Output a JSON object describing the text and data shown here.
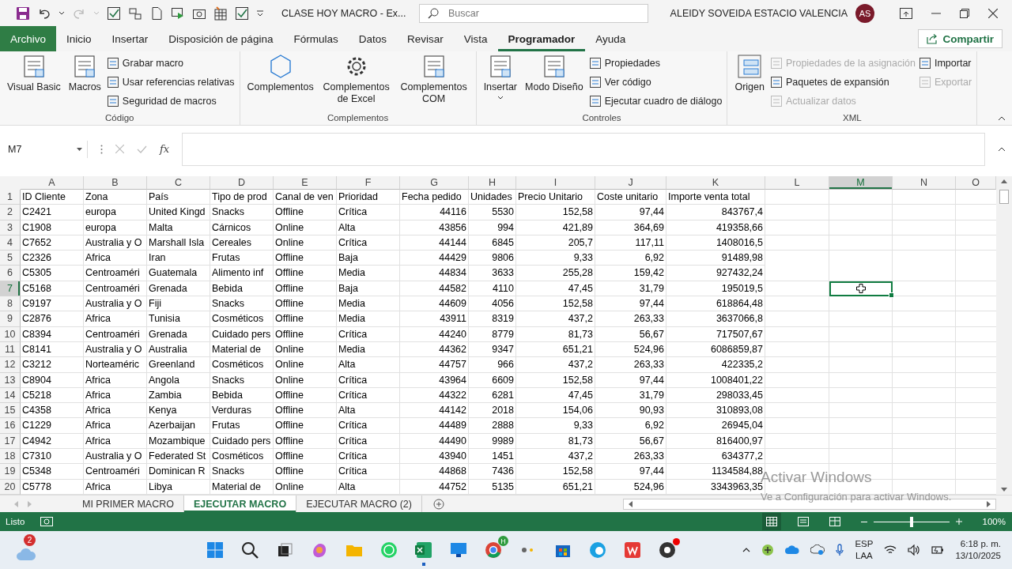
{
  "title_bar": {
    "title": "CLASE HOY MACRO  -  Ex...",
    "search": {
      "placeholder": "Buscar"
    },
    "user_name": "ALEIDY SOVEIDA ESTACIO VALENCIA",
    "avatar": "AS"
  },
  "menu_tabs": [
    {
      "label": "Archivo",
      "kind": "file",
      "selected": false
    },
    {
      "label": "Inicio",
      "kind": "tab",
      "selected": false
    },
    {
      "label": "Insertar",
      "kind": "tab",
      "selected": false
    },
    {
      "label": "Disposición de página",
      "kind": "tab",
      "selected": false
    },
    {
      "label": "Fórmulas",
      "kind": "tab",
      "selected": false
    },
    {
      "label": "Datos",
      "kind": "tab",
      "selected": false
    },
    {
      "label": "Revisar",
      "kind": "tab",
      "selected": false
    },
    {
      "label": "Vista",
      "kind": "tab",
      "selected": false
    },
    {
      "label": "Programador",
      "kind": "tab",
      "selected": true
    },
    {
      "label": "Ayuda",
      "kind": "tab",
      "selected": false
    }
  ],
  "share_button": "Compartir",
  "ribbon_groups": [
    {
      "label": "Código",
      "items": [
        {
          "kind": "large",
          "label": "Visual Basic",
          "disabled": false
        },
        {
          "kind": "large",
          "label": "Macros",
          "disabled": false
        },
        {
          "kind": "small",
          "label": "Grabar macro",
          "disabled": false
        },
        {
          "kind": "small",
          "label": "Usar referencias relativas",
          "disabled": false
        },
        {
          "kind": "small",
          "label": "Seguridad de macros",
          "disabled": false
        }
      ]
    },
    {
      "label": "Complementos",
      "items": [
        {
          "kind": "large",
          "label": "Complementos",
          "disabled": false
        },
        {
          "kind": "large",
          "label": "Complementos de Excel",
          "disabled": false
        },
        {
          "kind": "large",
          "label": "Complementos COM",
          "disabled": false
        }
      ]
    },
    {
      "label": "Controles",
      "items": [
        {
          "kind": "dropdown",
          "label": "Insertar",
          "disabled": false
        },
        {
          "kind": "large",
          "label": "Modo Diseño",
          "disabled": false
        },
        {
          "kind": "small",
          "label": "Propiedades",
          "disabled": false
        },
        {
          "kind": "small",
          "label": "Ver código",
          "disabled": false
        },
        {
          "kind": "small",
          "label": "Ejecutar cuadro de diálogo",
          "disabled": false
        }
      ]
    },
    {
      "label": "XML",
      "items": [
        {
          "kind": "large",
          "label": "Origen",
          "disabled": false
        },
        {
          "kind": "small",
          "label": "Propiedades de la asignación",
          "disabled": true
        },
        {
          "kind": "small",
          "label": "Paquetes de expansión",
          "disabled": false
        },
        {
          "kind": "small",
          "label": "Actualizar datos",
          "disabled": true
        },
        {
          "kind": "small",
          "label": "Importar",
          "disabled": false
        },
        {
          "kind": "small",
          "label": "Exportar",
          "disabled": true
        }
      ]
    }
  ],
  "formula_bar": {
    "name_box": "M7",
    "fx": "fx"
  },
  "columns": [
    {
      "letter": "A",
      "kind": "text",
      "selected": false
    },
    {
      "letter": "B",
      "kind": "text",
      "selected": false
    },
    {
      "letter": "C",
      "kind": "text",
      "selected": false
    },
    {
      "letter": "D",
      "kind": "text",
      "selected": false
    },
    {
      "letter": "E",
      "kind": "text",
      "selected": false
    },
    {
      "letter": "F",
      "kind": "text",
      "selected": false
    },
    {
      "letter": "G",
      "kind": "number",
      "selected": false
    },
    {
      "letter": "H",
      "kind": "number",
      "selected": false
    },
    {
      "letter": "I",
      "kind": "number",
      "selected": false
    },
    {
      "letter": "J",
      "kind": "number",
      "selected": false
    },
    {
      "letter": "K",
      "kind": "number",
      "selected": false
    },
    {
      "letter": "L",
      "kind": "text",
      "selected": false
    },
    {
      "letter": "M",
      "kind": "text",
      "selected": true
    },
    {
      "letter": "N",
      "kind": "text",
      "selected": false
    },
    {
      "letter": "O",
      "kind": "text",
      "selected": false
    }
  ],
  "rows": [
    {
      "number": "1",
      "kind": "header",
      "selected": false,
      "cells": [
        "ID Cliente",
        "Zona",
        "País",
        "Tipo de prod",
        "Canal de ven",
        "Prioridad",
        "Fecha pedido",
        "Unidades",
        "Precio Unitario",
        "Coste unitario",
        "Importe venta total"
      ]
    },
    {
      "number": "2",
      "kind": "data",
      "selected": false,
      "cells": [
        "C2421",
        "europa",
        "United Kingd",
        "Snacks",
        "Offline",
        "Crítica",
        "44116",
        "5530",
        "152,58",
        "97,44",
        "843767,4"
      ]
    },
    {
      "number": "3",
      "kind": "data",
      "selected": false,
      "cells": [
        "C1908",
        "europa",
        "Malta",
        "Cárnicos",
        "Online",
        "Alta",
        "43856",
        "994",
        "421,89",
        "364,69",
        "419358,66"
      ]
    },
    {
      "number": "4",
      "kind": "data",
      "selected": false,
      "cells": [
        "C7652",
        "Australia y O",
        "Marshall Isla",
        "Cereales",
        "Online",
        "Crítica",
        "44144",
        "6845",
        "205,7",
        "117,11",
        "1408016,5"
      ]
    },
    {
      "number": "5",
      "kind": "data",
      "selected": false,
      "cells": [
        "C2326",
        "Africa",
        "Iran",
        "Frutas",
        "Offline",
        "Baja",
        "44429",
        "9806",
        "9,33",
        "6,92",
        "91489,98"
      ]
    },
    {
      "number": "6",
      "kind": "data",
      "selected": false,
      "cells": [
        "C5305",
        "Centroaméri",
        "Guatemala",
        "Alimento inf",
        "Offline",
        "Media",
        "44834",
        "3633",
        "255,28",
        "159,42",
        "927432,24"
      ]
    },
    {
      "number": "7",
      "kind": "data",
      "selected": true,
      "cells": [
        "C5168",
        "Centroaméri",
        "Grenada",
        "Bebida",
        "Offline",
        "Baja",
        "44582",
        "4110",
        "47,45",
        "31,79",
        "195019,5"
      ]
    },
    {
      "number": "8",
      "kind": "data",
      "selected": false,
      "cells": [
        "C9197",
        "Australia y O",
        "Fiji",
        "Snacks",
        "Offline",
        "Media",
        "44609",
        "4056",
        "152,58",
        "97,44",
        "618864,48"
      ]
    },
    {
      "number": "9",
      "kind": "data",
      "selected": false,
      "cells": [
        "C2876",
        "Africa",
        "Tunisia",
        "Cosméticos",
        "Offline",
        "Media",
        "43911",
        "8319",
        "437,2",
        "263,33",
        "3637066,8"
      ]
    },
    {
      "number": "10",
      "kind": "data",
      "selected": false,
      "cells": [
        "C8394",
        "Centroaméri",
        "Grenada",
        "Cuidado pers",
        "Offline",
        "Crítica",
        "44240",
        "8779",
        "81,73",
        "56,67",
        "717507,67"
      ]
    },
    {
      "number": "11",
      "kind": "data",
      "selected": false,
      "cells": [
        "C8141",
        "Australia y O",
        "Australia",
        "Material de",
        "Online",
        "Media",
        "44362",
        "9347",
        "651,21",
        "524,96",
        "6086859,87"
      ]
    },
    {
      "number": "12",
      "kind": "data",
      "selected": false,
      "cells": [
        "C3212",
        "Norteaméric",
        "Greenland",
        "Cosméticos",
        "Online",
        "Alta",
        "44757",
        "966",
        "437,2",
        "263,33",
        "422335,2"
      ]
    },
    {
      "number": "13",
      "kind": "data",
      "selected": false,
      "cells": [
        "C8904",
        "Africa",
        "Angola",
        "Snacks",
        "Online",
        "Crítica",
        "43964",
        "6609",
        "152,58",
        "97,44",
        "1008401,22"
      ]
    },
    {
      "number": "14",
      "kind": "data",
      "selected": false,
      "cells": [
        "C5218",
        "Africa",
        "Zambia",
        "Bebida",
        "Offline",
        "Crítica",
        "44322",
        "6281",
        "47,45",
        "31,79",
        "298033,45"
      ]
    },
    {
      "number": "15",
      "kind": "data",
      "selected": false,
      "cells": [
        "C4358",
        "Africa",
        "Kenya",
        "Verduras",
        "Offline",
        "Alta",
        "44142",
        "2018",
        "154,06",
        "90,93",
        "310893,08"
      ]
    },
    {
      "number": "16",
      "kind": "data",
      "selected": false,
      "cells": [
        "C1229",
        "Africa",
        "Azerbaijan",
        "Frutas",
        "Offline",
        "Crítica",
        "44489",
        "2888",
        "9,33",
        "6,92",
        "26945,04"
      ]
    },
    {
      "number": "17",
      "kind": "data",
      "selected": false,
      "cells": [
        "C4942",
        "Africa",
        "Mozambique",
        "Cuidado pers",
        "Offline",
        "Crítica",
        "44490",
        "9989",
        "81,73",
        "56,67",
        "816400,97"
      ]
    },
    {
      "number": "18",
      "kind": "data",
      "selected": false,
      "cells": [
        "C7310",
        "Australia y O",
        "Federated St",
        "Cosméticos",
        "Offline",
        "Crítica",
        "43940",
        "1451",
        "437,2",
        "263,33",
        "634377,2"
      ]
    },
    {
      "number": "19",
      "kind": "data",
      "selected": false,
      "cells": [
        "C5348",
        "Centroaméri",
        "Dominican R",
        "Snacks",
        "Offline",
        "Crítica",
        "44868",
        "7436",
        "152,58",
        "97,44",
        "1134584,88"
      ]
    },
    {
      "number": "20",
      "kind": "data",
      "selected": false,
      "cells": [
        "C5778",
        "Africa",
        "Libya",
        "Material de",
        "Online",
        "Alta",
        "44752",
        "5135",
        "651,21",
        "524,96",
        "3343963,35"
      ]
    }
  ],
  "sheet_tabs": [
    {
      "label": "MI PRIMER MACRO",
      "selected": false
    },
    {
      "label": "EJECUTAR MACRO",
      "selected": true
    },
    {
      "label": "EJECUTAR MACRO (2)",
      "selected": false
    }
  ],
  "activation_notice": {
    "title": "Activar Windows",
    "message": "Ve a Configuración para activar Windows."
  },
  "status_bar": {
    "status": "Listo",
    "zoom": {
      "level": 0.5,
      "reading": "100%"
    }
  },
  "taskbar": {
    "weather_badge": "2",
    "chrome_badge": "H",
    "language": "ESP",
    "layout": "LAA",
    "time": "6:18 p. m.",
    "date": "13/10/2025"
  }
}
